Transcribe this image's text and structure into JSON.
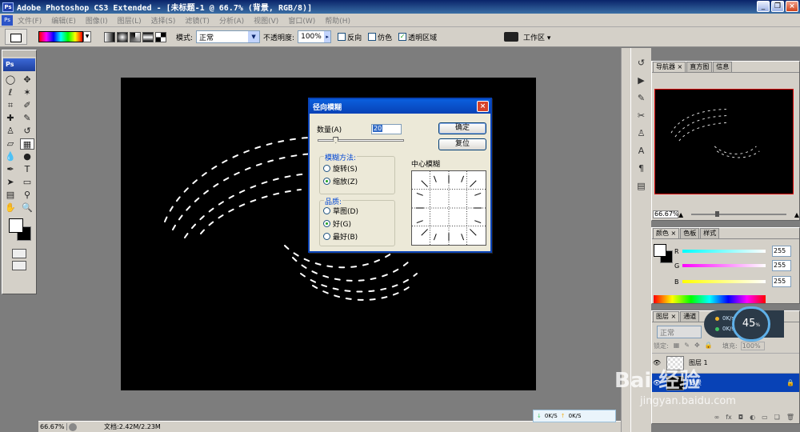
{
  "titlebar": {
    "title": "Adobe Photoshop CS3 Extended - [未标题-1 @ 66.7% (背景, RGB/8)]",
    "app_badge": "Ps"
  },
  "window_buttons": {
    "minimize": "_",
    "restore": "❐",
    "close": "×"
  },
  "menu": [
    "文件(F)",
    "编辑(E)",
    "图像(I)",
    "图层(L)",
    "选择(S)",
    "滤镜(T)",
    "分析(A)",
    "视图(V)",
    "窗口(W)",
    "帮助(H)"
  ],
  "options": {
    "mode_label": "模式:",
    "mode_value": "正常",
    "opacity_label": "不透明度:",
    "opacity_value": "100%",
    "reverse_label": "反向",
    "dither_label": "仿色",
    "transparency_label": "透明区域",
    "workspace_label": "工作区 ▾"
  },
  "toolbox": {
    "logo": "Ps"
  },
  "statusbar": {
    "zoom": "66.67%",
    "doc": "文档:2.42M/2.23M"
  },
  "dialog": {
    "title": "径向模糊",
    "amount_label": "数量(A)",
    "amount_value": "20",
    "amount_fraction": 0.2,
    "ok_label": "确定",
    "reset_label": "复位",
    "method_legend": "模糊方法:",
    "method_spin": "旋转(S)",
    "method_zoom": "缩放(Z)",
    "quality_legend": "品质:",
    "quality_draft": "草图(D)",
    "quality_good": "好(G)",
    "quality_best": "最好(B)",
    "center_label": "中心模糊"
  },
  "navigator": {
    "tabs": [
      "导航器 ×",
      "直方图",
      "信息"
    ],
    "zoom": "66.67%"
  },
  "color_panel": {
    "tabs": [
      "颜色 ×",
      "色板",
      "样式"
    ],
    "r_label": "R",
    "r_value": "255",
    "g_label": "G",
    "g_value": "255",
    "b_label": "B",
    "b_value": "255"
  },
  "layers": {
    "tabs": [
      "图层 ×",
      "通道"
    ],
    "blend": "正常",
    "lock_label": "锁定:",
    "fill_label": "填充:",
    "fill_value": "100%",
    "items": [
      {
        "name": "图层 1"
      },
      {
        "name": "背景"
      }
    ]
  },
  "network": {
    "up": "0K/s",
    "down": "0K/s",
    "percent": "45",
    "percent_unit": "%",
    "bar_down": "0K/S",
    "bar_up": "0K/S"
  },
  "watermark": {
    "brand": "Bai 经验",
    "url": "jingyan.baidu.com"
  },
  "colors": {
    "title_blue": "#0a246a",
    "dialog_blue": "#0842b6",
    "selection": "#0842b6"
  }
}
